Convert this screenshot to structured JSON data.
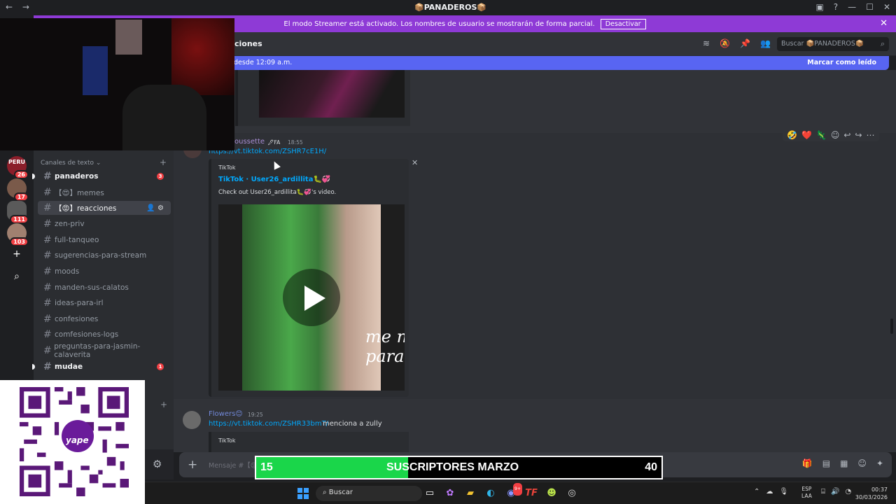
{
  "titlebar": {
    "back_icon": "arrow-left-icon",
    "forward_icon": "arrow-right-icon",
    "title": "📦PANADEROS📦",
    "right_icons": [
      "inbox-icon",
      "help-icon",
      "minimize-icon",
      "maximize-icon",
      "close-icon"
    ]
  },
  "banner": {
    "text": "El modo Streamer está activado. Los nombres de usuario se mostrarán de forma parcial.",
    "button": "Desactivar",
    "close": "✕"
  },
  "servers": [
    {
      "name": "PERU",
      "badge": "26",
      "color": "#8b1e2a"
    },
    {
      "name": "",
      "badge": "17",
      "color": "#7a5a4a"
    },
    {
      "name": "",
      "badge": "111",
      "color": "#5a5a5a"
    },
    {
      "name": "",
      "badge": "103",
      "color": "#a08070"
    }
  ],
  "rail_buttons": {
    "add": "+",
    "discover": "⌕"
  },
  "sidebar": {
    "category": "Canales de texto ⌄",
    "category_add": "+",
    "channels": [
      {
        "name": "panaderos",
        "state": "unread",
        "badge": "3"
      },
      {
        "name": "【😍】memes",
        "state": "normal"
      },
      {
        "name": "【😡】reacciones",
        "state": "selected"
      },
      {
        "name": "zen-priv",
        "state": "normal"
      },
      {
        "name": "full-tanqueo",
        "state": "normal"
      },
      {
        "name": "sugerencias-para-stream",
        "state": "normal"
      },
      {
        "name": "moods",
        "state": "normal"
      },
      {
        "name": "manden-sus-calatos",
        "state": "normal"
      },
      {
        "name": "ideas-para-irl",
        "state": "normal"
      },
      {
        "name": "confesiones",
        "state": "normal"
      },
      {
        "name": "comfesiones-logs",
        "state": "normal"
      },
      {
        "name": "preguntas-para-jasmin-calaverita",
        "state": "normal"
      },
      {
        "name": "mudae",
        "state": "unread",
        "badge": "1"
      }
    ],
    "bottom_add": "+"
  },
  "header": {
    "title": "ciones",
    "icons": [
      "threads-icon",
      "mute-icon",
      "pin-icon",
      "members-icon"
    ],
    "search_placeholder": "Buscar 📦PANADEROS📦"
  },
  "new_messages": {
    "text": "desde 12:09 a.m.",
    "action": "Marcar como leído"
  },
  "messages": [
    {
      "author": "oussette",
      "tag": "🖋FA",
      "time": "18:55",
      "link": "https://vt.tiktok.com/ZSHR7cE1H/",
      "embed": {
        "provider": "TikTok",
        "title": "TikTok · User26_ardillita🐛💞",
        "description": "Check out User26_ardillita🐛💞's video.",
        "video_text": "me n\npara"
      }
    },
    {
      "author": "Flowers😊",
      "time": "19:25",
      "link": "https://vt.tiktok.com/ZSHR33bmT/",
      "text": "menciona a zully",
      "embed": {
        "provider": "TikTok"
      }
    }
  ],
  "reactions": [
    "🤣",
    "❤️",
    "🦎"
  ],
  "composer": {
    "placeholder": "Mensaje #【😡"
  },
  "goal": {
    "current": "15",
    "label": "SUSCRIPTORES MARZO",
    "target": "40",
    "progress": 0.375
  },
  "qr": {
    "brand": "yape"
  },
  "taskbar": {
    "search": "Buscar",
    "apps": [
      "file-explorer-icon",
      "copilot-icon",
      "folder-icon",
      "edge-icon",
      "discord-icon",
      "tf-icon",
      "app-icon",
      "chrome-icon"
    ],
    "discord_badge": "9+",
    "lang_top": "ESP",
    "lang_bottom": "LAA",
    "time": "00:37",
    "date": "30/03/2026"
  }
}
